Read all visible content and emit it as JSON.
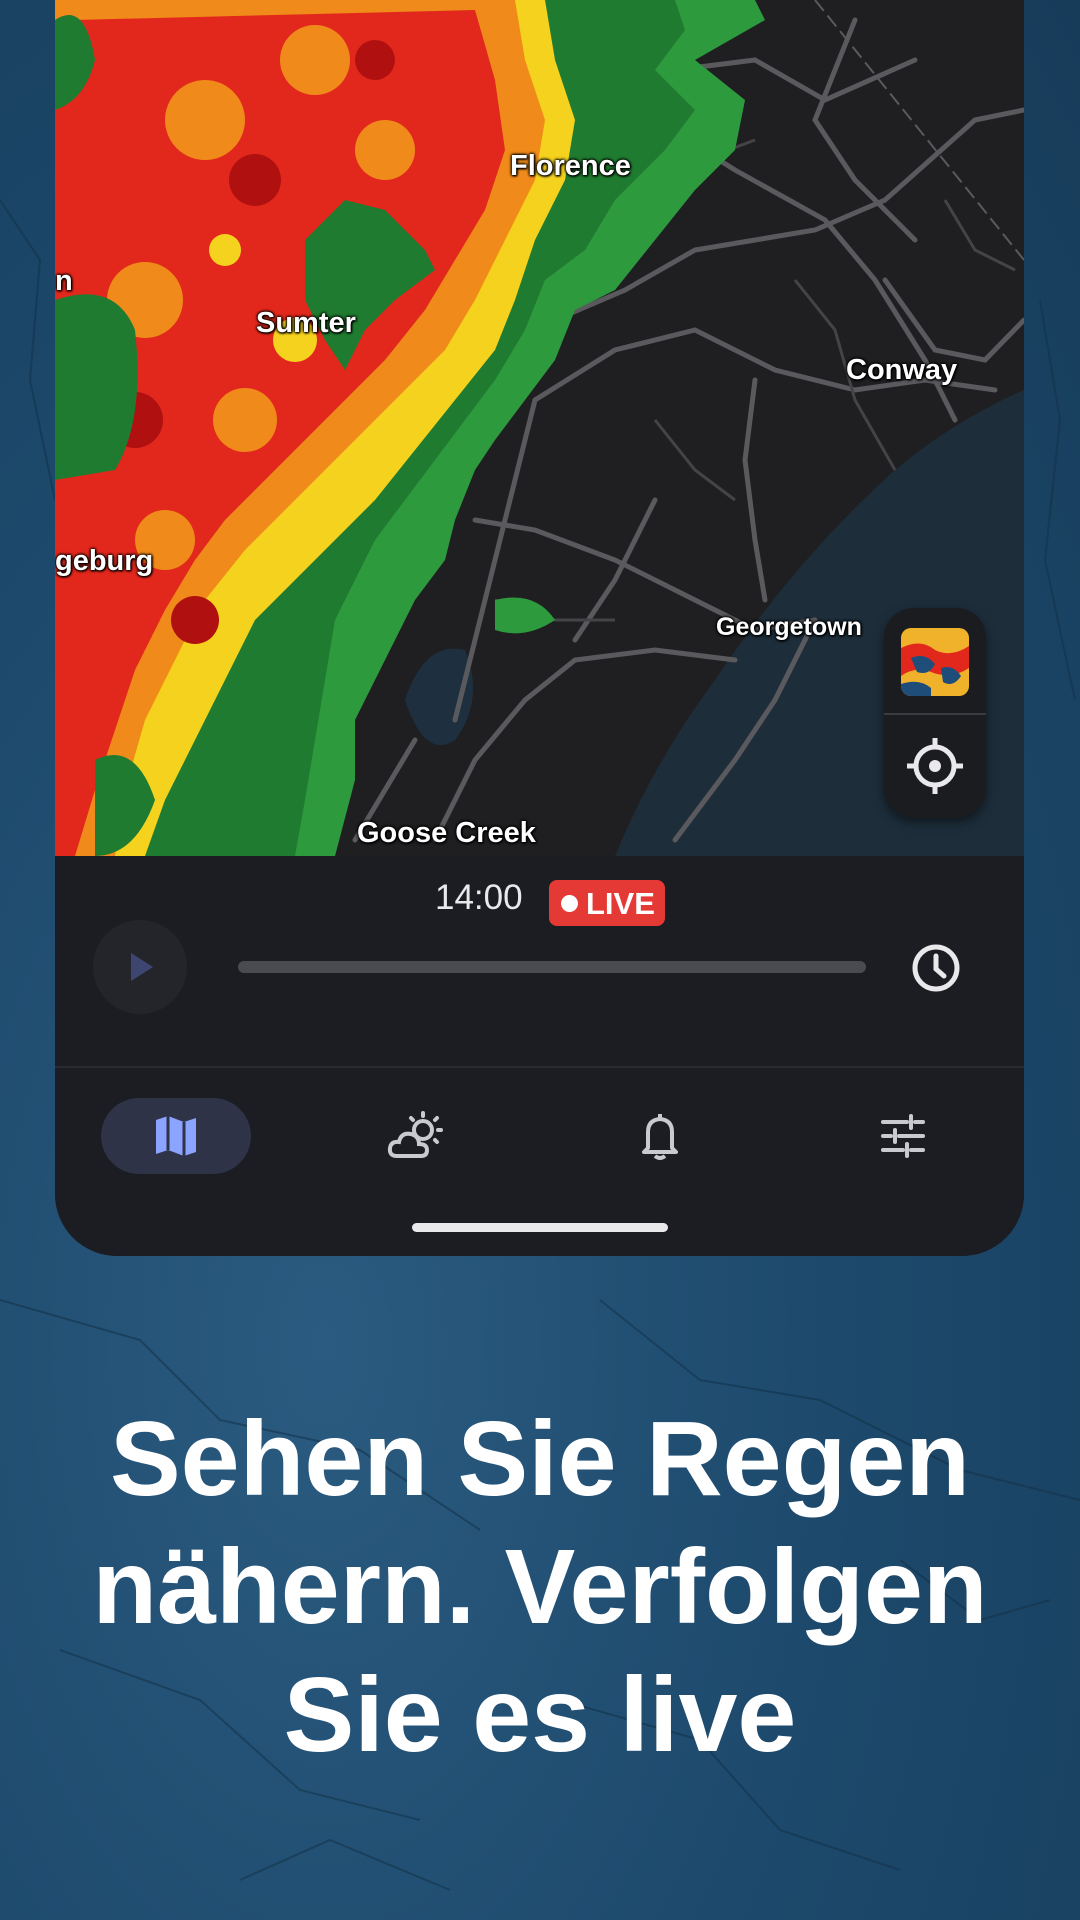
{
  "map": {
    "cities": [
      {
        "name": "Florence"
      },
      {
        "name": "Sumter"
      },
      {
        "name": "Conway"
      },
      {
        "name": "geburg"
      },
      {
        "name": "Georgetown"
      },
      {
        "name": "Goose Creek"
      },
      {
        "name": "n"
      }
    ]
  },
  "controls": {
    "radar_layer_icon": "radar-thumbnail",
    "locate_icon": "crosshair-icon"
  },
  "timeline": {
    "time": "14:00",
    "live_label": "LIVE",
    "play_icon": "play-icon",
    "history_icon": "clock-icon",
    "progress": 1.0
  },
  "nav": {
    "items": [
      {
        "icon": "map-icon",
        "active": true
      },
      {
        "icon": "weather-icon",
        "active": false
      },
      {
        "icon": "bell-icon",
        "active": false
      },
      {
        "icon": "settings-sliders-icon",
        "active": false
      }
    ]
  },
  "headline": {
    "line1": "Sehen Sie Regen",
    "line2": "nähern. Verfolgen",
    "line3": "Sie es live"
  },
  "colors": {
    "accent": "#e53935",
    "nav_active": "#8ba4ff",
    "background": "#1d4a6d"
  }
}
